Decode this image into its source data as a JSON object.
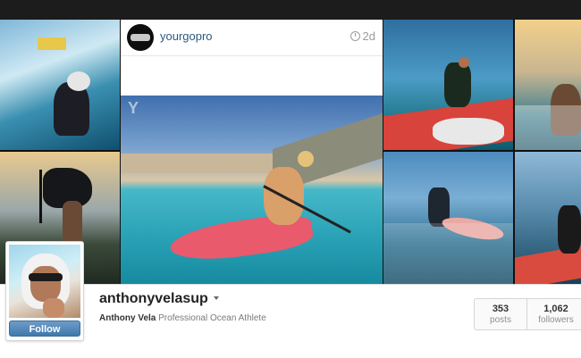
{
  "post": {
    "username": "yourgopro",
    "time": "2d",
    "watermark": "Y"
  },
  "profile": {
    "username": "anthonyvelasup",
    "full_name": "Anthony Vela",
    "bio": "Professional Ocean Athlete",
    "follow_label": "Follow",
    "stats": [
      {
        "value": "353",
        "label": "posts"
      },
      {
        "value": "1,062",
        "label": "followers"
      }
    ]
  },
  "colors": {
    "link": "#2b5a83",
    "follow_button": "#3e79ad",
    "top_bar": "#1c1c1c"
  }
}
